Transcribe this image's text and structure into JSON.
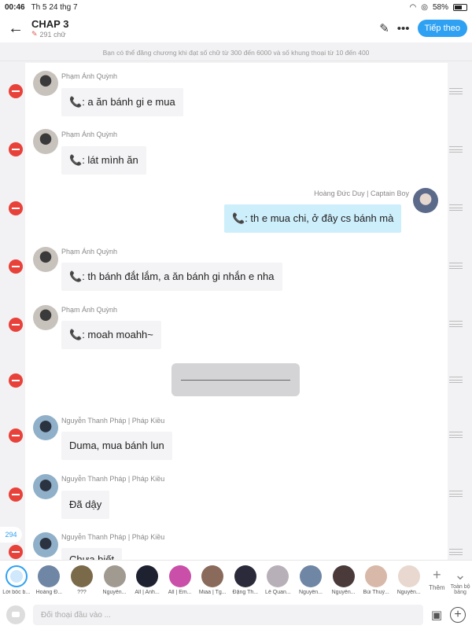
{
  "status_bar": {
    "time": "00:46",
    "date": "Th 5 24 thg 7",
    "battery": "58%"
  },
  "header": {
    "title": "CHAP 3",
    "word_count": "291 chữ",
    "next_label": "Tiếp theo"
  },
  "notice": "Bạn có thể đăng chương khi đạt số chữ từ 300 đến 6000 và số khung thoại từ 10 đến 400",
  "messages": [
    {
      "name": "Phạm Ánh Quỳnh",
      "text": ": a ăn bánh gi e mua"
    },
    {
      "name": "Phạm Ánh Quỳnh",
      "text": ": lát mình ăn"
    },
    {
      "name": "Hoàng Đức Duy | Captain Boy",
      "text": ": th e mua chi, ở đây cs bánh mà"
    },
    {
      "name": "Phạm Ánh Quỳnh",
      "text": ": th bánh đắt lắm, a ăn bánh gi nhắn e nha"
    },
    {
      "name": "Phạm Ánh Quỳnh",
      "text": ": moah moahh~"
    },
    {
      "name": "Nguyễn Thanh Pháp | Pháp Kiều",
      "text": "Duma, mua bánh lun"
    },
    {
      "name": "Nguyễn Thanh Pháp | Pháp Kiều",
      "text": "Đã dậy"
    },
    {
      "name": "Nguyễn Thanh Pháp | Pháp Kiều",
      "text": "Chưa biết"
    }
  ],
  "frame_count_badge": "294",
  "characters": [
    {
      "label": "Lời bốc b..."
    },
    {
      "label": "Hoàng Đ..."
    },
    {
      "label": "???"
    },
    {
      "label": "Nguyễn..."
    },
    {
      "label": "All | Anh..."
    },
    {
      "label": "All | Em..."
    },
    {
      "label": "Miaa | Tg..."
    },
    {
      "label": "Đặng Th..."
    },
    {
      "label": "Lê Quan..."
    },
    {
      "label": "Nguyễn..."
    },
    {
      "label": "Nguyễn..."
    },
    {
      "label": "Bùi Thuỳ..."
    },
    {
      "label": "Nguyễn..."
    }
  ],
  "add_label": "Thêm",
  "expand_label": "Toàn bộ bảng",
  "input_placeholder": "Đối thoại đầu vào ...",
  "icons": {
    "back": "back-arrow-icon",
    "edit": "pencil-icon",
    "more": "more-icon",
    "delete": "minus-icon",
    "drag": "drag-handle-icon",
    "phone": "phone-icon",
    "image": "image-icon",
    "add": "plus-icon"
  },
  "colors": {
    "accent": "#2ea1f2",
    "delete": "#e8413a",
    "bubble_mine": "#cdeefb"
  }
}
